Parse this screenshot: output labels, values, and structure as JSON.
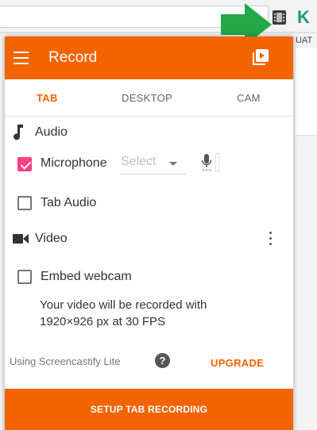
{
  "browser": {
    "bookmark_label": "UAT",
    "extension_letter": "K"
  },
  "header": {
    "title": "Record",
    "menu_icon": "hamburger-menu-icon",
    "library_icon": "video-library-icon"
  },
  "tabs": [
    {
      "label": "TAB",
      "active": true
    },
    {
      "label": "DESKTOP",
      "active": false
    },
    {
      "label": "CAM",
      "active": false
    }
  ],
  "audio": {
    "section_label": "Audio",
    "microphone": {
      "label": "Microphone",
      "checked": true,
      "select_value": "Select"
    },
    "tab_audio": {
      "label": "Tab Audio",
      "checked": false
    }
  },
  "video": {
    "section_label": "Video",
    "embed_webcam": {
      "label": "Embed webcam",
      "checked": false
    },
    "info_line1": "Your video will be recorded with",
    "info_line2": "1920×926 px at 30 FPS"
  },
  "footer": {
    "lite_text": "Using Screencastify Lite",
    "help_symbol": "?",
    "upgrade_label": "UPGRADE",
    "setup_button": "SETUP TAB RECORDING"
  },
  "colors": {
    "accent": "#f26400",
    "checkbox_checked": "#ff4081",
    "annotation_arrow": "#22a845"
  }
}
